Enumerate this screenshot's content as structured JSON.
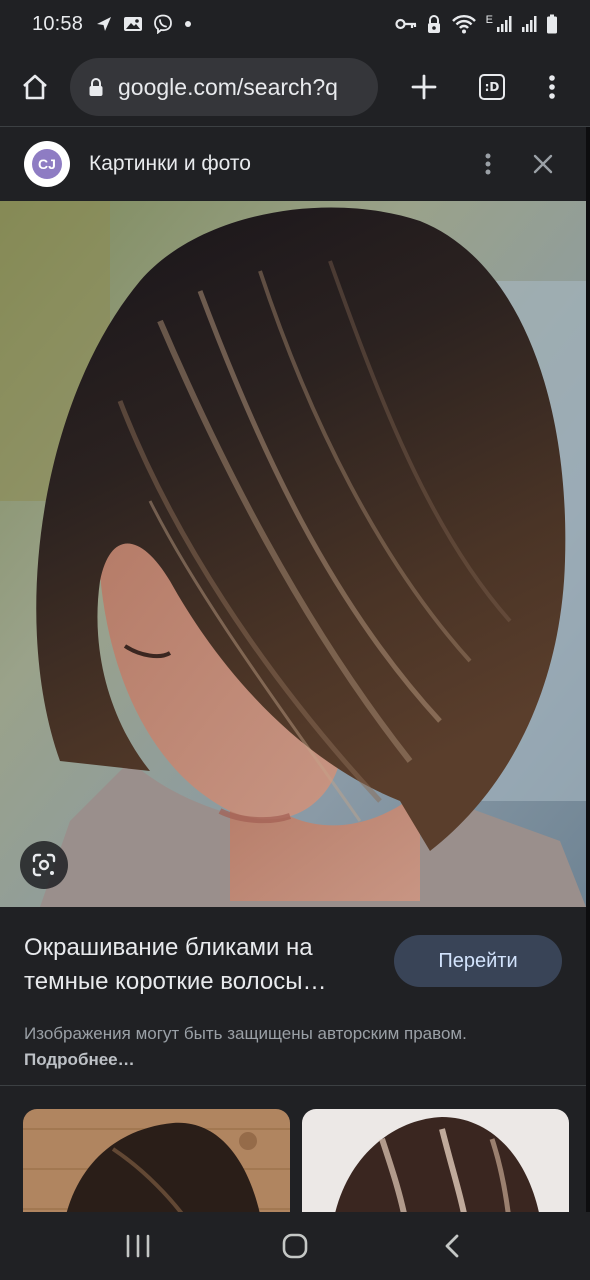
{
  "status_bar": {
    "time": "10:58",
    "network_label": "E",
    "left_icons": [
      "navigation-icon",
      "gallery-icon",
      "viber-icon",
      "dot-icon"
    ],
    "right_icons": [
      "key-icon",
      "lock-icon",
      "wifi-icon",
      "signal-icon",
      "signal-icon",
      "battery-icon"
    ]
  },
  "browser": {
    "url": "google.com/search?q",
    "tab_count_label": ":D"
  },
  "panel": {
    "title": "Картинки и фото",
    "site_logo_text": "CJ"
  },
  "result": {
    "title": "Окрашивание бликами на темные короткие волосы…",
    "go_button_label": "Перейти",
    "copyright_text": "Изображения могут быть защищены авторским правом.",
    "more_link": "Подробнее…"
  },
  "colors": {
    "background": "#202124",
    "button_bg": "#394457",
    "button_text": "#d2e3fc",
    "secondary_text": "#9aa0a6"
  }
}
